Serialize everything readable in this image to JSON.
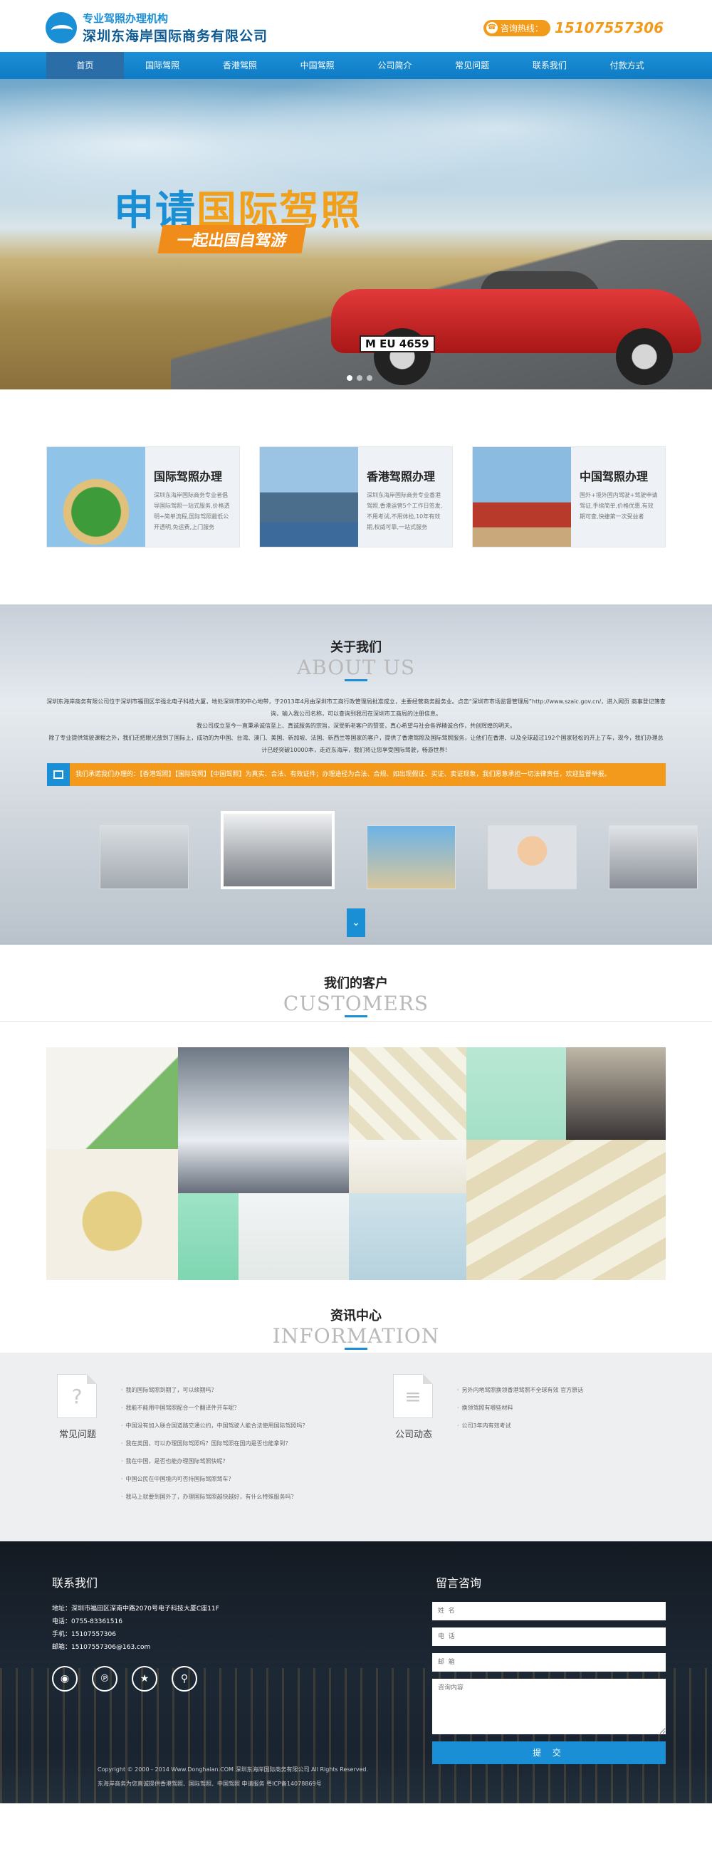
{
  "header": {
    "logo_line1": "专业驾照办理机构",
    "logo_line2": "深圳东海岸国际商务有限公司",
    "hotline_label": "咨询热线：",
    "hotline_number": "15107557306"
  },
  "nav": {
    "items": [
      {
        "label": "首页"
      },
      {
        "label": "国际驾照"
      },
      {
        "label": "香港驾照"
      },
      {
        "label": "中国驾照"
      },
      {
        "label": "公司简介"
      },
      {
        "label": "常见问题"
      },
      {
        "label": "联系我们"
      },
      {
        "label": "付款方式"
      }
    ]
  },
  "banner": {
    "title_part1": "申请",
    "title_part2": "国际驾照",
    "subtitle": "一起出国自驾游",
    "plate": "M EU 4659"
  },
  "services": [
    {
      "title": "国际驾照办理",
      "desc": "深圳东海岸国际商务专业者倡导国际驾照一站式服务,价格透明+简单流程,国际驾照最低公开透明,免运费,上门服务"
    },
    {
      "title": "香港驾照办理",
      "desc": "深圳东海岸国际商务专业香港驾照,香港运营5个工作日签发,不用考试,不用体检,10年有效期,权威可靠,一站式服务"
    },
    {
      "title": "中国驾照办理",
      "desc": "国外+境外国内驾驶+驾驶申请驾证,手续简单,价格优惠,有效期可查,快捷第一次受益者"
    }
  ],
  "about": {
    "title_cn": "关于我们",
    "title_en": "ABOUT US",
    "paragraph1": "深圳东海岸商务有限公司位于深圳市福田区华强北电子科技大厦，地处深圳市的中心地带，于2013年4月由深圳市工商行政管理局批准成立，主要经营商务服务业。点击“深圳市市场监督管理局”http://www.szaic.gov.cn/，进入网页 商事登记簿查询，输入我公司名称，可以查询到我司在深圳市工商局的注册信息。",
    "paragraph2": "我公司成立至今一直秉承诚信至上、真诚服务的宗旨，深受新老客户的赞誉，真心希望与社会各界精诚合作，共创辉煌的明天。",
    "paragraph3": "除了专业提供驾驶课程之外，我们还把眼光放到了国际上，成功的为中国、台湾、澳门、美国、新加坡、法国、新西兰等国家的客户，提供了香港驾照及国际驾照服务，让他们在香港、以及全球超过192个国家轻松的开上了车，现今，我们办理总计已经突破10000本，走近东海岸，我们将让您享受国际驾驶，畅游世界！",
    "ticker": "我们承诺我们办理的：【香港驾照】【国际驾照】【中国驾照】为真实、合法、有效证件；办理途径为合法、合规、如出现假证、买证、卖证现象，我们愿意承担一切法律责任，欢迎监督举报。",
    "more": "⌄"
  },
  "customers": {
    "title_cn": "我们的客户",
    "title_en": "CUSTOMERS"
  },
  "information": {
    "title_cn": "资讯中心",
    "title_en": "INFORMATION",
    "faq_title": "常见问题",
    "news_title": "公司动态",
    "faq_items": [
      "我的国际驾照到期了，可以续期吗？",
      "我能不能用中国驾照配合一个翻译件开车呢？",
      "中国没有加入联合国道路交通公约，中国驾驶人能合法使用国际驾照吗？",
      "我在英国，可以办理国际驾照吗？国际驾照在国内是否也能拿到？",
      "我在中国，是否也能办理国际驾照快呢？",
      "中国公民在中国境内可否持国际驾照驾车？",
      "我马上就要到国外了，办理国际驾照越快越好，有什么特殊服务吗？"
    ],
    "news_items": [
      "另外内地驾照换领香港驾照不全球有效 官方原话",
      "换领驾照有哪些材料",
      "公司3年内有效考试"
    ]
  },
  "footer": {
    "contact_title": "联系我们",
    "message_title": "留言咨询",
    "address": "地址：深圳市福田区深南中路2070号电子科技大厦C座11F",
    "tel": "电话：0755-83361516",
    "mobile": "手机：15107557306",
    "email": "邮箱：15107557306@163.com",
    "form": {
      "name_placeholder": "姓  名",
      "phone_placeholder": "电  话",
      "email_placeholder": "邮  箱",
      "content_placeholder": "咨询内容",
      "submit": "提 交"
    },
    "copyright_line1": "Copyright © 2000 - 2014  Www.Donghaian.COM  深圳东海岸国际商务有限公司  All Rights Reserved.",
    "copyright_line2": "东海岸商务为您直诚提供香港驾照、国际驾照、中国驾照 申请服务 粤ICP备14078869号"
  },
  "colors": {
    "brand_blue": "#1a8fd6",
    "accent_orange": "#f39a1c"
  }
}
